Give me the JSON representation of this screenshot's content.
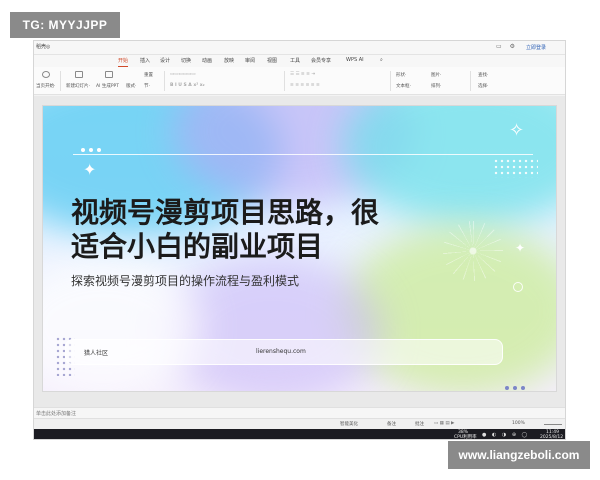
{
  "watermarks": {
    "top_left": "TG: MYYJJPP",
    "bottom_right": "www.liangzeboli.com"
  },
  "window": {
    "doc_tab": "稻壳◎",
    "login": "立即登录",
    "icons": [
      "window-icon",
      "settings-icon",
      "user-icon"
    ]
  },
  "menu": {
    "items": [
      "开始",
      "插入",
      "设计",
      "切换",
      "动画",
      "放映",
      "审阅",
      "视图",
      "工具",
      "会员专享",
      "WPS AI"
    ],
    "active_index": 0
  },
  "ribbon": {
    "groups": [
      {
        "top": "",
        "bottom": "当页开始·"
      },
      {
        "top": "",
        "bottom": "新建幻灯片·"
      },
      {
        "top": "",
        "bottom": "AI 生成PPT"
      },
      {
        "top": "",
        "bottom": "版式·"
      },
      {
        "top": "重置",
        "bottom": "节·"
      },
      {
        "top": "形状·",
        "bottom": "文本框·"
      },
      {
        "top": "图片·",
        "bottom": "排列·"
      },
      {
        "top": "查找·",
        "bottom": "选择·"
      }
    ]
  },
  "slide": {
    "title_line1": "视频号漫剪项目思路，很",
    "title_line2": "适合小白的副业项目",
    "subtitle": "探索视频号漫剪项目的操作流程与盈利模式",
    "footer_left": "猎人社区",
    "footer_right": "lierenshequ.com"
  },
  "notes": {
    "label": "单击此处添加备注"
  },
  "status": {
    "smart_beautify": "智能美化",
    "notes": "备注",
    "comments": "批注",
    "zoom": "100%"
  },
  "taskbar": {
    "cpu_percent": "38%",
    "cpu_label": "CPU利用率",
    "time": "11:49",
    "date": "2025/8/12"
  }
}
